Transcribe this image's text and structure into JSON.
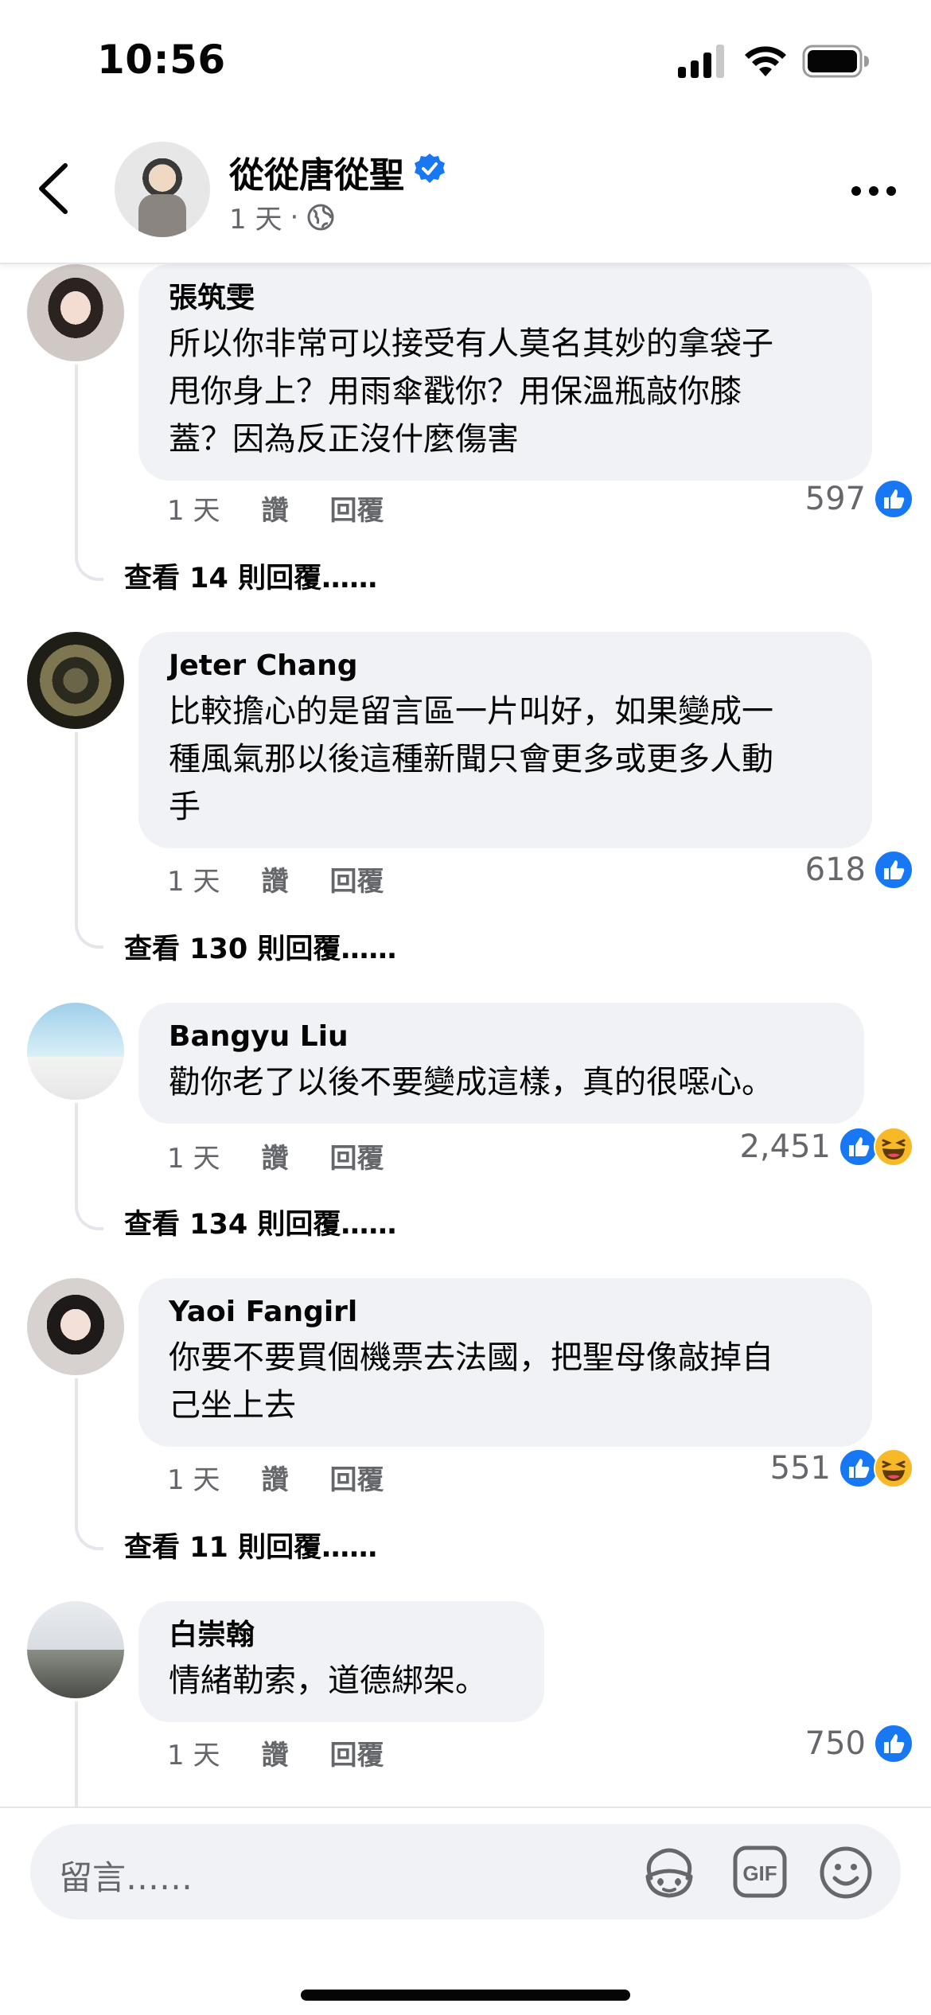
{
  "status_bar": {
    "time": "10:56"
  },
  "header": {
    "name": "從從唐從聖",
    "time": "1 天",
    "separator": "·"
  },
  "comments": [
    {
      "name": "張筑雯",
      "text_lines": [
        "所以你非常可以接受有人莫名其妙的拿袋子",
        "甩你身上？用雨傘戳你？用保溫瓶敲你膝",
        "蓋？因為反正沒什麼傷害"
      ],
      "time": "1 天",
      "like_label": "讚",
      "reply_label": "回覆",
      "count": "597",
      "reactions": [
        "like"
      ],
      "view_replies": "查看 14 則回覆……"
    },
    {
      "name": "Jeter Chang",
      "text_lines": [
        "比較擔心的是留言區一片叫好，如果變成一",
        "種風氣那以後這種新聞只會更多或更多人動",
        "手"
      ],
      "time": "1 天",
      "like_label": "讚",
      "reply_label": "回覆",
      "count": "618",
      "reactions": [
        "like"
      ],
      "view_replies": "查看 130 則回覆……"
    },
    {
      "name": "Bangyu Liu",
      "text_lines": [
        "勸你老了以後不要變成這樣，真的很噁心。"
      ],
      "time": "1 天",
      "like_label": "讚",
      "reply_label": "回覆",
      "count": "2,451",
      "reactions": [
        "like",
        "haha"
      ],
      "view_replies": "查看 134 則回覆……"
    },
    {
      "name": "Yaoi Fangirl",
      "text_lines": [
        "你要不要買個機票去法國，把聖母像敲掉自",
        "己坐上去"
      ],
      "time": "1 天",
      "like_label": "讚",
      "reply_label": "回覆",
      "count": "551",
      "reactions": [
        "like",
        "haha"
      ],
      "view_replies": "查看 11 則回覆……"
    },
    {
      "name": "白崇翰",
      "text_lines": [
        "情緒勒索，道德綁架。"
      ],
      "time": "1 天",
      "like_label": "讚",
      "reply_label": "回覆",
      "count": "750",
      "reactions": [
        "like"
      ],
      "view_replies": ""
    }
  ],
  "composer": {
    "placeholder": "留言……",
    "gif_label": "GIF"
  },
  "colors": {
    "accent": "#1877f2",
    "bubble": "#f0f2f5",
    "secondary_text": "#65676b",
    "haha": "#f7b928"
  }
}
